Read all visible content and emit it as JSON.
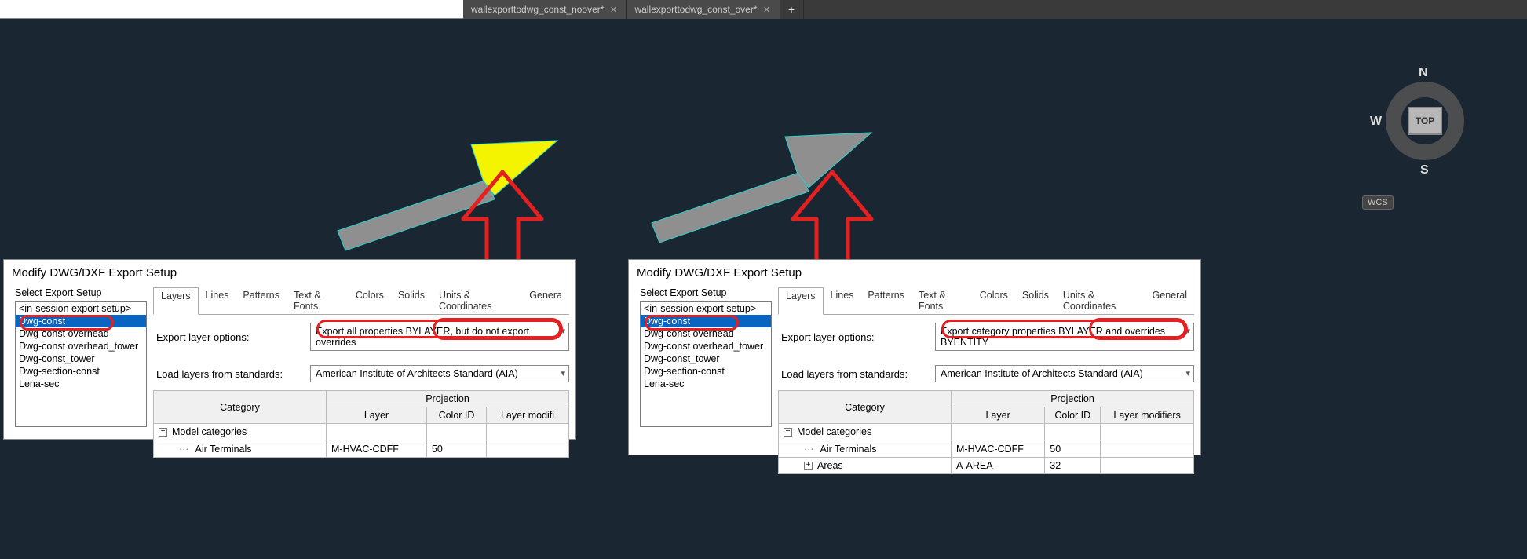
{
  "tabs": {
    "t1": "wallexporttodwg_const_noover*",
    "t2": "wallexporttodwg_const_over*"
  },
  "nav": {
    "n": "N",
    "s": "S",
    "w": "W",
    "top": "TOP",
    "wcs": "WCS"
  },
  "dialog_title": "Modify DWG/DXF Export Setup",
  "setup_label": "Select Export Setup",
  "setup_items": {
    "i0": "<in-session export setup>",
    "i1": "Dwg-const",
    "i2": "Dwg-const overhead",
    "i3": "Dwg-const overhead_tower",
    "i4": "Dwg-const_tower",
    "i5": "Dwg-section-const",
    "i6": "Lena-sec"
  },
  "tabs_row": {
    "layers": "Layers",
    "lines": "Lines",
    "patterns": "Patterns",
    "text": "Text & Fonts",
    "colors": "Colors",
    "solids": "Solids",
    "units": "Units & Coordinates",
    "general": "General",
    "general_short": "Genera"
  },
  "form": {
    "export_layer_label": "Export layer options:",
    "load_layers_label": "Load layers from standards:",
    "opt_left": "Export all properties BYLAYER, but do not export overrides",
    "opt_right": "Export category properties BYLAYER and overrides BYENTITY",
    "standard": "American Institute of Architects Standard (AIA)"
  },
  "grid": {
    "category": "Category",
    "projection": "Projection",
    "layer": "Layer",
    "colorid": "Color ID",
    "layermod": "Layer modifi",
    "layermod_long": "Layer modifiers",
    "modelcat": "Model categories",
    "airterm": "Air Terminals",
    "areas": "Areas",
    "mhvac": "M-HVAC-CDFF",
    "aarea": "A-AREA",
    "c50": "50",
    "c32": "32"
  }
}
